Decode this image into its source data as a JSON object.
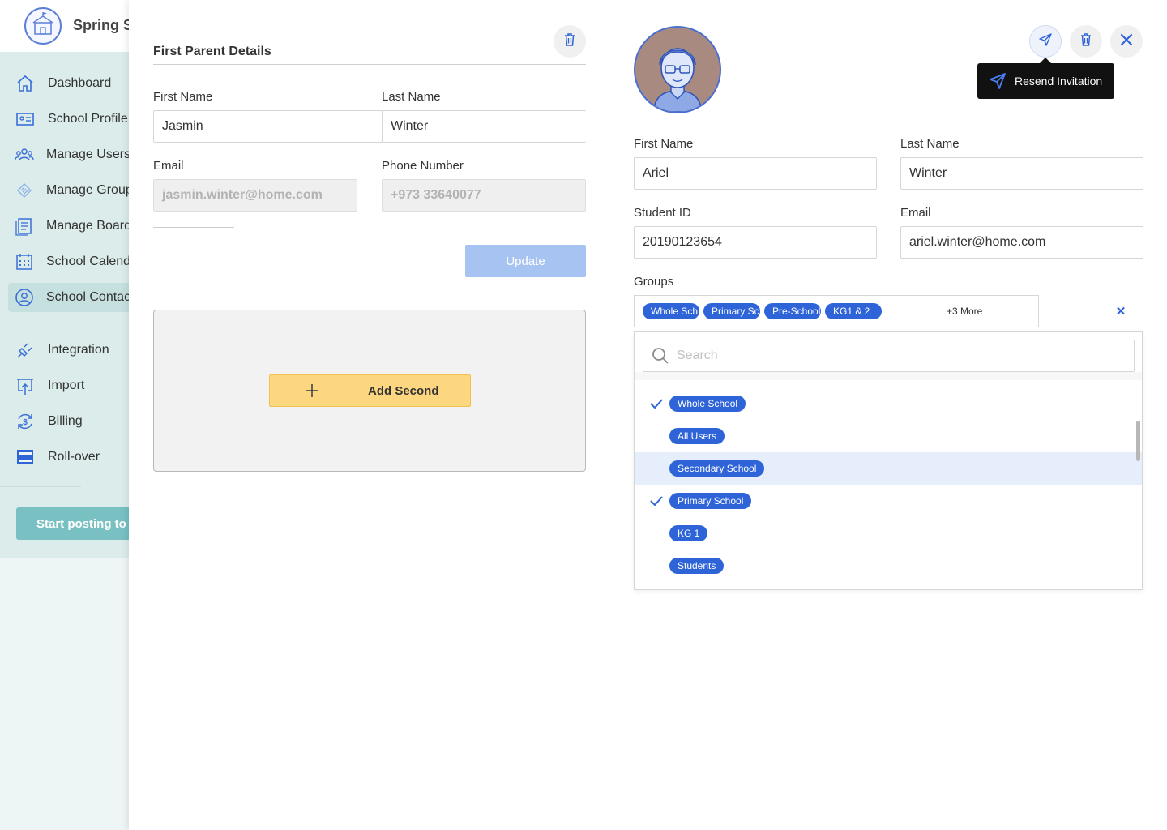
{
  "app": {
    "brand_name": "Spring S"
  },
  "sidebar": {
    "items": [
      {
        "label": "Dashboard",
        "icon": "home-icon"
      },
      {
        "label": "School Profile",
        "icon": "id-card-icon"
      },
      {
        "label": "Manage Users",
        "icon": "users-icon"
      },
      {
        "label": "Manage Group",
        "icon": "groups-icon"
      },
      {
        "label": "Manage Board",
        "icon": "board-icon"
      },
      {
        "label": "School Calend",
        "icon": "calendar-icon"
      },
      {
        "label": "School Contac",
        "icon": "contact-icon"
      },
      {
        "label": "Integration",
        "icon": "plug-icon"
      },
      {
        "label": "Import",
        "icon": "import-icon"
      },
      {
        "label": "Billing",
        "icon": "billing-icon"
      },
      {
        "label": "Roll-over",
        "icon": "rollover-icon"
      }
    ],
    "start_posting": "Start posting to b"
  },
  "first_parent": {
    "title": "First Parent Details",
    "first_name_label": "First Name",
    "first_name": "Jasmin",
    "last_name_label": "Last Name",
    "last_name": "Winter",
    "email_label": "Email",
    "email": "jasmin.winter@home.com",
    "phone_label": "Phone Number",
    "phone": "+973 33640077",
    "update_label": "Update",
    "add_second_label": "Add Second"
  },
  "student": {
    "tooltip": "Resend Invitation",
    "first_name_label": "First Name",
    "first_name": "Ariel",
    "last_name_label": "Last Name",
    "last_name": "Winter",
    "student_id_label": "Student ID",
    "student_id": "20190123654",
    "email_label": "Email",
    "email": "ariel.winter@home.com",
    "groups_label": "Groups",
    "selected_chips": [
      "Whole Sch",
      "Primary Sc",
      "Pre-School",
      "KG1 & 2"
    ],
    "more_label": "+3 More",
    "search_placeholder": "Search",
    "options": [
      {
        "label": "Whole School",
        "checked": true
      },
      {
        "label": "All Users",
        "checked": false
      },
      {
        "label": "Secondary School",
        "checked": false,
        "hover": true
      },
      {
        "label": "Primary School",
        "checked": true
      },
      {
        "label": "KG 1",
        "checked": false
      },
      {
        "label": "Students",
        "checked": false
      }
    ]
  },
  "colors": {
    "accent": "#2f64d8",
    "sidebar_bg": "#dbeceb",
    "add_button": "#fdd680",
    "start_button": "#78c0c2"
  }
}
